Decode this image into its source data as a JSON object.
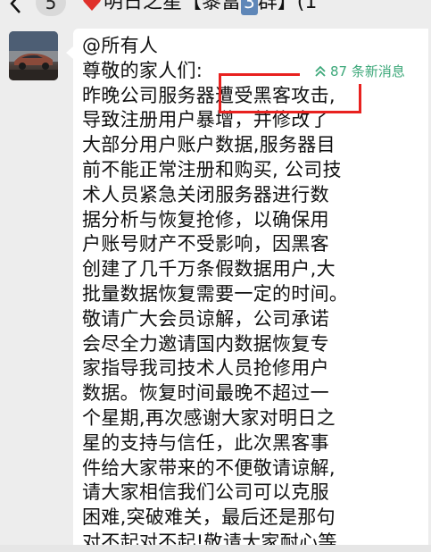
{
  "header": {
    "unread_count": "5",
    "title_prefix": "明日之星【黎富",
    "title_tag": "3",
    "title_suffix": "群】(1",
    "title_overflow": "..."
  },
  "message": {
    "lines": [
      "@所有人",
      "尊敬的家人们:",
      "昨晚公司服务器遭受黑客攻击,",
      "导致注册用户暴增，并修改了",
      "大部分用户账户数据,服务器目",
      "前不能正常注册和购买, 公司技",
      "术人员紧急关闭服务器进行数",
      "据分析与恢复抢修，以确保用",
      "户账号财产不受影响，因黑客",
      "创建了几千万条假数据用户,大",
      "批量数据恢复需要一定的时间。",
      "敬请广大会员谅解，公司承诺",
      "会尽全力邀请国内数据恢复专",
      "家指导我司技术人员抢修用户",
      "数据。恢复时间最晚不超过一",
      "个星期,再次感谢大家对明日之",
      "星的支持与信任，此次黑客事",
      "件给大家带来的不便敬请谅解,",
      "请大家相信我们公司可以克服",
      "困难,突破难关，最后还是那句",
      "对不起对不起!敬请大家耐心等"
    ]
  },
  "new_messages": {
    "label": "87 条新消息"
  },
  "colors": {
    "highlight": "#e8211f",
    "new_messages": "#3da87a",
    "background": "#ededed"
  }
}
